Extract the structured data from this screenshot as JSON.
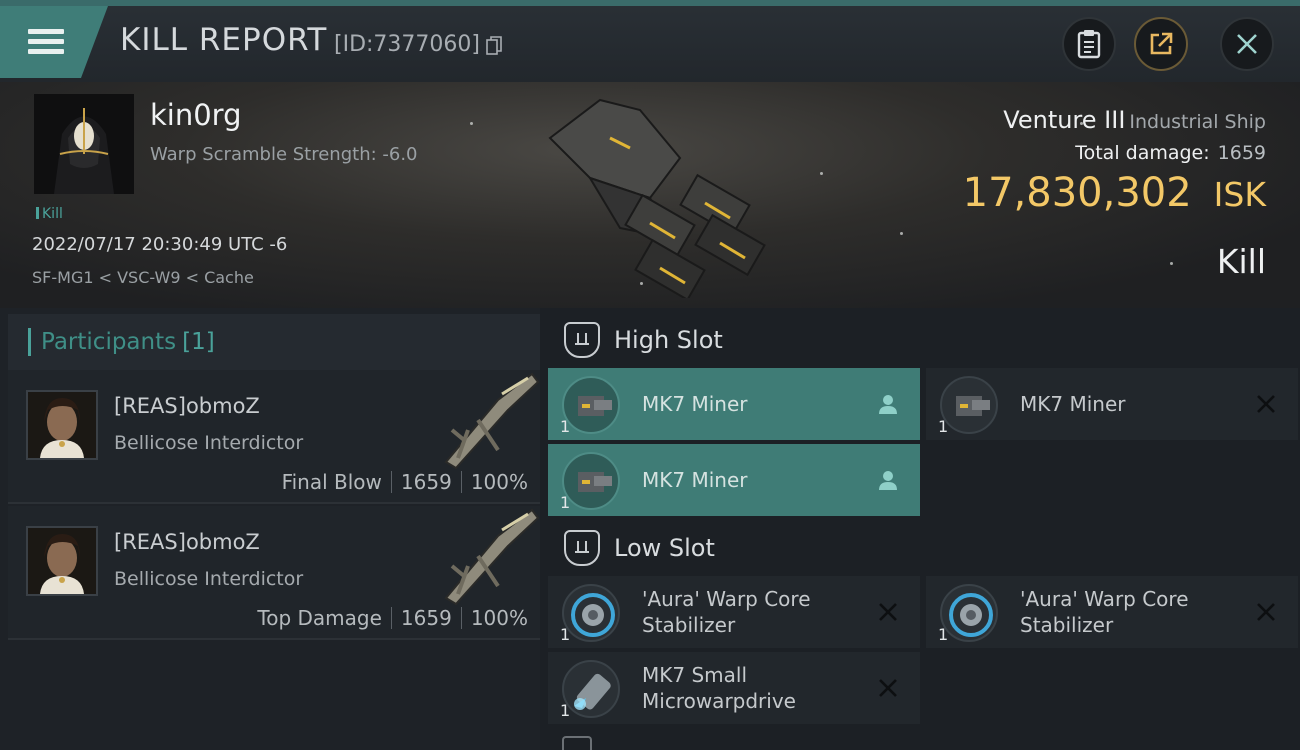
{
  "header": {
    "title": "KILL REPORT",
    "report_id": "[ID:7377060]",
    "buttons": [
      "clipboard-icon",
      "share-icon",
      "close-icon"
    ]
  },
  "victim": {
    "pilot_name": "kin0rg",
    "warp_scramble": "Warp Scramble Strength: -6.0",
    "tag": "Kill",
    "timestamp": "2022/07/17 20:30:49 UTC -6",
    "location": "SF-MG1 < VSC-W9 < Cache",
    "ship_name": "Venture III",
    "ship_class": "Industrial Ship",
    "total_damage_label": "Total damage:",
    "total_damage": "1659",
    "isk_value": "17,830,302",
    "isk_unit": "ISK",
    "result": "Kill"
  },
  "participants": {
    "title": "Participants",
    "count": "[1]",
    "items": [
      {
        "name": "[REAS]obmoZ",
        "ship": "Bellicose Interdictor",
        "role": "Final Blow",
        "damage": "1659",
        "percent": "100%"
      },
      {
        "name": "[REAS]obmoZ",
        "ship": "Bellicose Interdictor",
        "role": "Top Damage",
        "damage": "1659",
        "percent": "100%"
      }
    ]
  },
  "fitting": {
    "high_slot": {
      "title": "High Slot",
      "modules": [
        {
          "name": "MK7 Miner",
          "qty": "1",
          "status": "person-icon",
          "highlighted": true
        },
        {
          "name": "MK7 Miner",
          "qty": "1",
          "status": "destroyed-x-icon",
          "highlighted": false
        },
        {
          "name": "MK7 Miner",
          "qty": "1",
          "status": "person-icon",
          "highlighted": true
        }
      ]
    },
    "low_slot": {
      "title": "Low Slot",
      "modules": [
        {
          "name": "'Aura' Warp Core Stabilizer",
          "qty": "1",
          "status": "destroyed-x-icon"
        },
        {
          "name": "'Aura' Warp Core Stabilizer",
          "qty": "1",
          "status": "destroyed-x-icon"
        },
        {
          "name": "MK7 Small Microwarpdrive",
          "qty": "1",
          "status": "destroyed-x-icon"
        }
      ]
    }
  },
  "colors": {
    "accent": "#3f7d78",
    "isk": "#f3c867",
    "teal_text": "#4aa29a"
  }
}
